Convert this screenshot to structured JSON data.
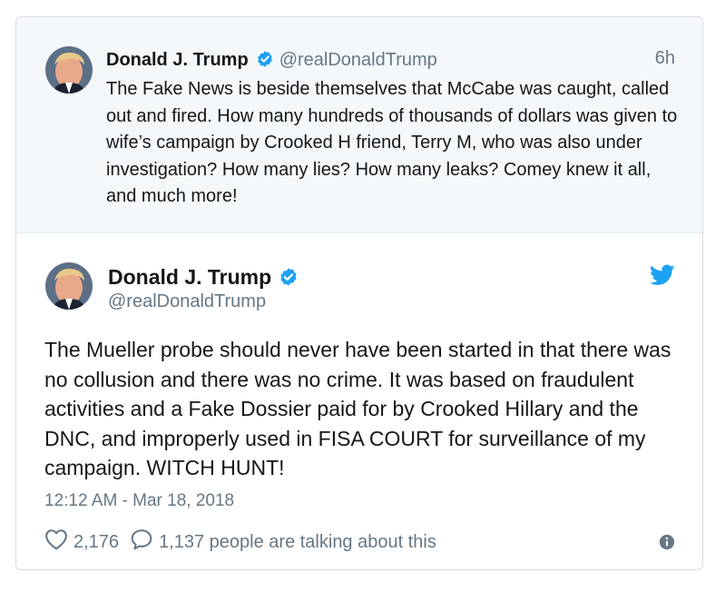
{
  "quoted_tweet": {
    "name": "Donald J. Trump",
    "handle": "@realDonaldTrump",
    "time": "6h",
    "text": "The Fake News is beside themselves that McCabe was caught, called out and fired. How many hundreds of thousands of dollars was given to wife’s campaign by Crooked H friend, Terry M, who was also under investigation? How many lies? How many leaks? Comey knew it all, and much more!"
  },
  "main_tweet": {
    "name": "Donald J. Trump",
    "handle": "@realDonaldTrump",
    "text": "The Mueller probe should never have been started in that there was no collusion and there was no crime. It was based on fraudulent activities and a Fake Dossier paid for by Crooked Hillary and the DNC, and improperly used in FISA COURT for surveillance of my campaign. WITCH HUNT!",
    "timestamp": "12:12 AM - Mar 18, 2018",
    "likes": "2,176",
    "talking": "1,137 people are talking about this"
  },
  "icons": {
    "verified": "verified-badge-icon",
    "bird": "twitter-bird-icon",
    "like": "heart-icon",
    "reply": "speech-bubble-icon",
    "info": "info-icon"
  },
  "colors": {
    "accent": "#1da1f2",
    "muted": "#657786",
    "text": "#14171a",
    "quoted_bg": "#f5f8fa"
  }
}
